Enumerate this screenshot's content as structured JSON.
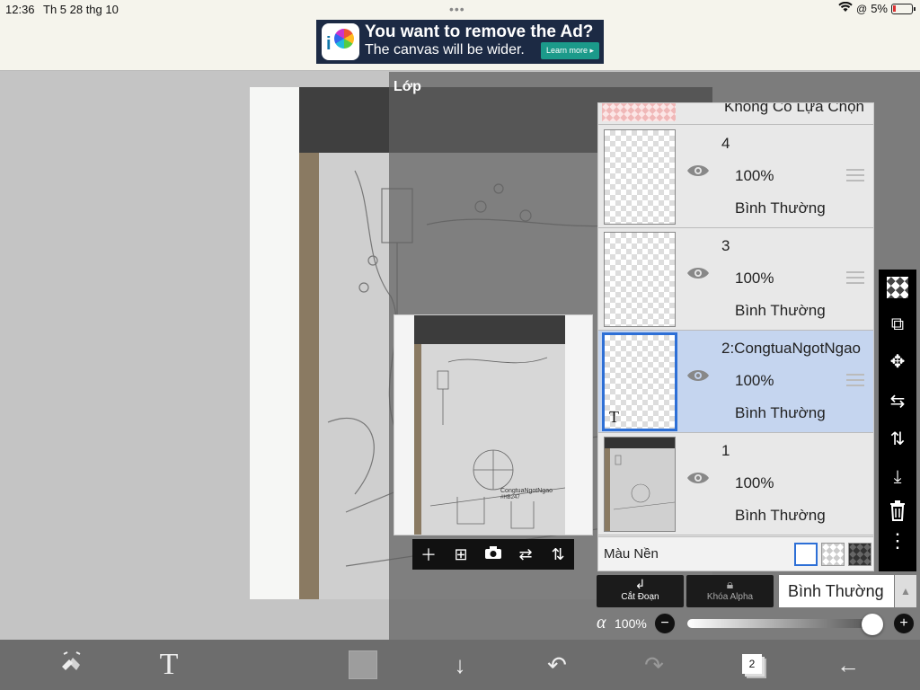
{
  "status": {
    "time": "12:36",
    "date": "Th 5 28 thg 10",
    "battery": "5%"
  },
  "ad": {
    "line1": "You want to remove the Ad?",
    "line2": "The canvas will be wider.",
    "button": "Learn more ▸"
  },
  "panel": {
    "title": "Lớp"
  },
  "selection_layer": {
    "label": "Không Có Lựa Chọn"
  },
  "layers": [
    {
      "name": "4",
      "opacity": "100%",
      "mode": "Bình Thường"
    },
    {
      "name": "3",
      "opacity": "100%",
      "mode": "Bình Thường"
    },
    {
      "name": "2:CongtuaNgotNgao",
      "opacity": "100%",
      "mode": "Bình Thường"
    },
    {
      "name": "1",
      "opacity": "100%",
      "mode": "Bình Thường"
    }
  ],
  "background": {
    "label": "Màu Nền"
  },
  "controls": {
    "clip_label": "Cắt Đoạn",
    "alpha_lock_label": "Khóa Alpha",
    "blend_mode": "Bình Thường",
    "alpha_symbol": "α",
    "alpha_value": "100%"
  },
  "preview": {
    "watermark": "CongtuaNgotNgao",
    "watermark2": "#HB247"
  },
  "bottombar": {
    "layer_count": "2"
  },
  "colors": {
    "selected": "#2d6fd6",
    "selected_row": "#c5d5ef"
  }
}
